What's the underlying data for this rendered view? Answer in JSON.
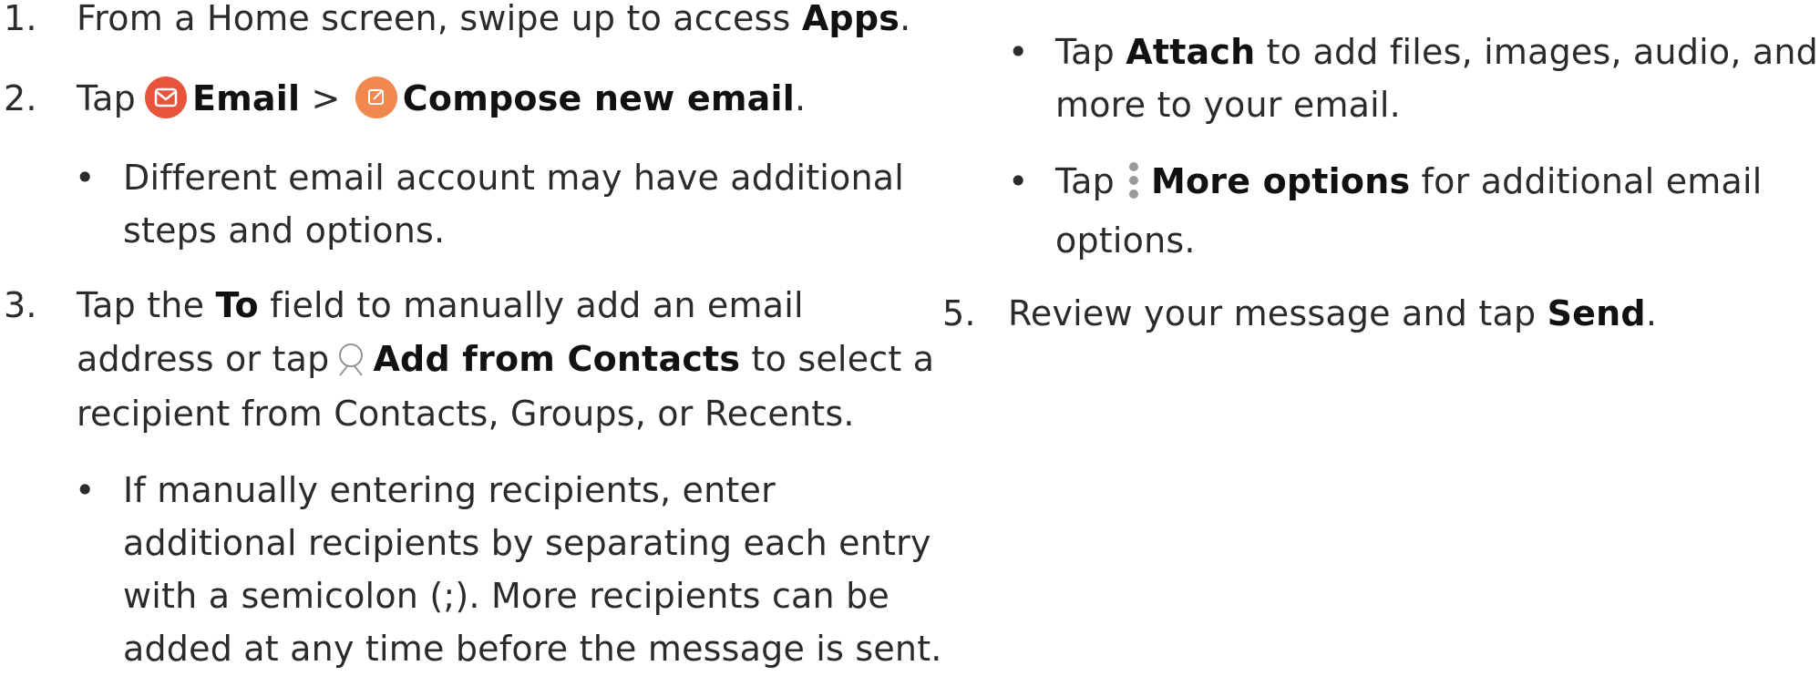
{
  "steps": {
    "s1": {
      "num": "1.",
      "pre": "From a Home screen, swipe up to access ",
      "b1": "Apps",
      "post": "."
    },
    "s2": {
      "num": "2.",
      "pre": "Tap",
      "b1": "Email",
      "sep": " > ",
      "b2": "Compose new email",
      "post": "."
    },
    "s2_bullet": {
      "line1": "Different email account may have additional",
      "line2": "steps and options."
    },
    "s3": {
      "num": "3.",
      "l1_pre": "Tap the ",
      "l1_b": "To",
      "l1_post": " field to manually add an email",
      "l2_pre": "address or tap",
      "l2_b": "Add from Contacts",
      "l2_post": " to select a",
      "l3": "recipient from Contacts, Groups, or Recents."
    },
    "s3_bullet": {
      "line1": "If manually entering recipients, enter",
      "line2": "additional recipients by separating each entry",
      "line3": "with a semicolon (;). More recipients can be",
      "line4": "added at any time before the message is sent."
    },
    "attach_bullet": {
      "pre": "Tap ",
      "b": "Attach",
      "post": " to add files, images, audio, and",
      "line2": "more to your email."
    },
    "more_bullet": {
      "pre": "Tap",
      "b": "More options",
      "post": " for additional email",
      "line2": "options."
    },
    "s5": {
      "num": "5.",
      "pre": "Review your message and tap ",
      "b": "Send",
      "post": "."
    }
  },
  "icons": {
    "email": "email-app-icon",
    "compose": "compose-icon",
    "contacts": "contact-icon",
    "more": "more-options-icon"
  },
  "colors": {
    "email_icon": "#e8533b",
    "compose_icon": "#f0884f",
    "more_icon": "#9a9a9a",
    "bullet": "•"
  }
}
